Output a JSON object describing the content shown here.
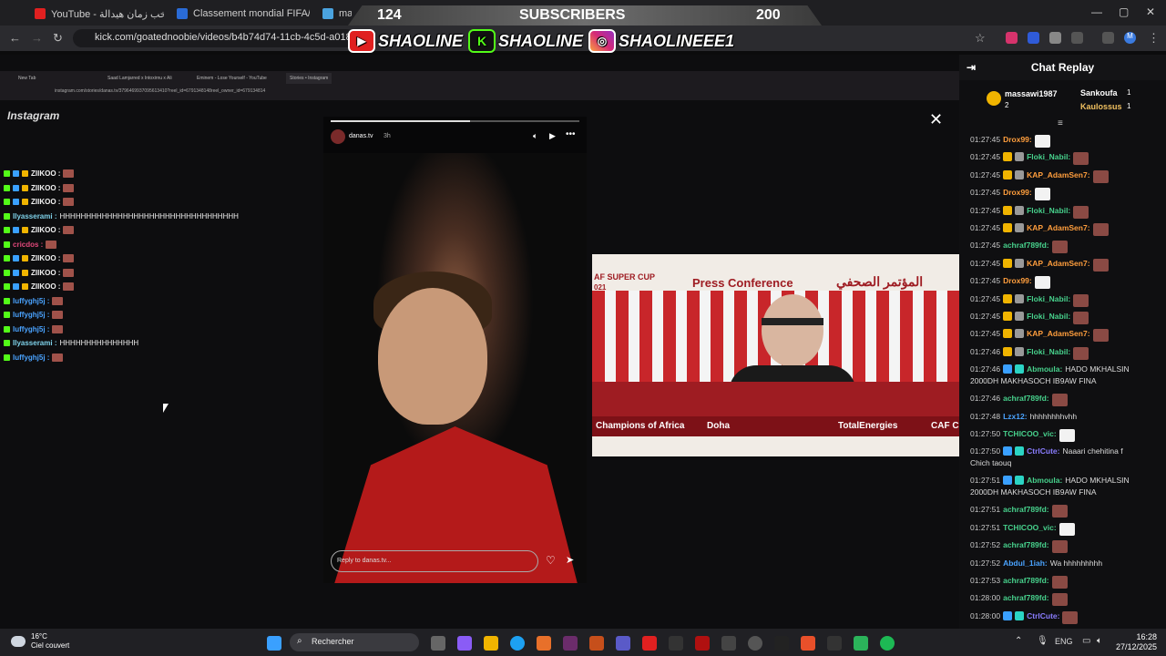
{
  "tabs": [
    {
      "title": "YouTube - منتخب زمان هيدالة",
      "favicon_color": "#e02020"
    },
    {
      "title": "Classement mondial FIFA/Coca",
      "favicon_color": "#2a6bd6"
    },
    {
      "title": "mali -",
      "favicon_color": "#4aa3df"
    }
  ],
  "browser": {
    "url": "kick.com/goatednoobie/videos/b4b74d74-11cb-4c5d-a018-835514",
    "avatar_letter": "M"
  },
  "banner": {
    "left_count": "124",
    "label": "SUBSCRIBERS",
    "right_count": "200",
    "accounts": [
      "SHAOLINE",
      "SHAOLINE",
      "SHAOLINEEE1"
    ]
  },
  "inner_browser": {
    "tabs": [
      "New Tab",
      "Saad Lamjarred x Intoxirnu x Ali",
      "Eminem - Lose Yourself - YouTube",
      "Stories • Instagram"
    ],
    "url": "instagram.com/stories/danas.tv/3796469937095613410?reel_id=6791348148reel_owner_id=679134814"
  },
  "instagram": {
    "logo": "Instagram",
    "story_user": "danas.tv",
    "story_time": "3h",
    "reply_placeholder": "Reply to danas.tv...",
    "progress": 0.56
  },
  "stream_chat": [
    {
      "user": "ZIIKOO :",
      "color": "#f2f2f2"
    },
    {
      "user": "ZIIKOO :",
      "color": "#f2f2f2"
    },
    {
      "user": "ZIIKOO :",
      "color": "#f2f2f2"
    },
    {
      "user": "Ilyasserami :",
      "color": "#7ed1e9",
      "text": "HHHHHHHHHHHHHHHHHHHHHHHHHHHHHHHHHH"
    },
    {
      "user": "ZIIKOO :",
      "color": "#f2f2f2"
    },
    {
      "user": "cricdos :",
      "color": "#e0487a"
    },
    {
      "user": "ZIIKOO :",
      "color": "#f2f2f2"
    },
    {
      "user": "ZIIKOO :",
      "color": "#f2f2f2"
    },
    {
      "user": "ZIIKOO :",
      "color": "#f2f2f2"
    },
    {
      "user": "luffyghj5j :",
      "color": "#4aa3ff"
    },
    {
      "user": "luffyghj5j :",
      "color": "#4aa3ff"
    },
    {
      "user": "luffyghj5j :",
      "color": "#4aa3ff"
    },
    {
      "user": "Ilyasserami :",
      "color": "#7ed1e9",
      "text": "HHHHHHHHHHHHHHH"
    },
    {
      "user": "luffyghj5j :",
      "color": "#4aa3ff"
    }
  ],
  "pip": {
    "title_en": "Press Conference",
    "title_ar": "المؤتمر الصحفي",
    "cup": "AF SUPER CUP",
    "year": "021",
    "footer_left": "Champions of Africa",
    "footer_city": "Doha",
    "footer_sponsor": "TotalEnergies",
    "footer_right": "CAF C"
  },
  "chat_replay": {
    "title": "Chat Replay",
    "top_gifters": [
      {
        "name": "massawi1987",
        "count": "2"
      },
      {
        "name": "Sankoufa",
        "count": "1"
      },
      {
        "name": "Kaulossus",
        "count": "1"
      }
    ],
    "messages": [
      {
        "time": "01:27:45",
        "user": "Drox99:",
        "color": "#ff9e3d",
        "emote": "white"
      },
      {
        "time": "01:27:45",
        "user": "Floki_Nabil:",
        "color": "#47d18c",
        "emote": "red"
      },
      {
        "time": "01:27:45",
        "user": "KAP_AdamSen7:",
        "color": "#ff9e3d",
        "emote": "red"
      },
      {
        "time": "01:27:45",
        "user": "Drox99:",
        "color": "#ff9e3d",
        "emote": "white"
      },
      {
        "time": "01:27:45",
        "user": "Floki_Nabil:",
        "color": "#47d18c",
        "emote": "red"
      },
      {
        "time": "01:27:45",
        "user": "KAP_AdamSen7:",
        "color": "#ff9e3d",
        "emote": "red"
      },
      {
        "time": "01:27:45",
        "user": "achraf789fd:",
        "color": "#47d18c",
        "emote": "red"
      },
      {
        "time": "01:27:45",
        "user": "KAP_AdamSen7:",
        "color": "#ff9e3d",
        "emote": "red"
      },
      {
        "time": "01:27:45",
        "user": "Drox99:",
        "color": "#ff9e3d",
        "emote": "white"
      },
      {
        "time": "01:27:45",
        "user": "Floki_Nabil:",
        "color": "#47d18c",
        "emote": "red"
      },
      {
        "time": "01:27:45",
        "user": "Floki_Nabil:",
        "color": "#47d18c",
        "emote": "red"
      },
      {
        "time": "01:27:45",
        "user": "KAP_AdamSen7:",
        "color": "#ff9e3d",
        "emote": "red"
      },
      {
        "time": "01:27:46",
        "user": "Floki_Nabil:",
        "color": "#47d18c",
        "emote": "red"
      },
      {
        "time": "01:27:46",
        "user": "Abmoula:",
        "color": "#47d18c",
        "text": "HADO MKHALSIN",
        "text2": "2000DH MAKHASOCH IB9AW FINA"
      },
      {
        "time": "01:27:46",
        "user": "achraf789fd:",
        "color": "#47d18c",
        "emote": "red"
      },
      {
        "time": "01:27:48",
        "user": "Lzx12:",
        "color": "#4aa3ff",
        "text": "hhhhhhhhvhh"
      },
      {
        "time": "01:27:50",
        "user": "TCHICOO_vic:",
        "color": "#47d18c",
        "emote": "white"
      },
      {
        "time": "01:27:50",
        "user": "CtrlCute:",
        "color": "#8a7dff",
        "text": "Naaari chehitina f",
        "text2": "Chich taouq"
      },
      {
        "time": "01:27:51",
        "user": "Abmoula:",
        "color": "#47d18c",
        "text": "HADO MKHALSIN",
        "text2": "2000DH MAKHASOCH IB9AW FINA"
      },
      {
        "time": "01:27:51",
        "user": "achraf789fd:",
        "color": "#47d18c",
        "emote": "red"
      },
      {
        "time": "01:27:51",
        "user": "TCHICOO_vic:",
        "color": "#47d18c",
        "emote": "white"
      },
      {
        "time": "01:27:52",
        "user": "achraf789fd:",
        "color": "#47d18c",
        "emote": "red"
      },
      {
        "time": "01:27:52",
        "user": "Abdul_1iah:",
        "color": "#4aa3ff",
        "text": "Wa hhhhhhhhh"
      },
      {
        "time": "01:27:53",
        "user": "achraf789fd:",
        "color": "#47d18c",
        "emote": "red"
      },
      {
        "time": "01:28:00",
        "user": "achraf789fd:",
        "color": "#47d18c",
        "emote": "red"
      },
      {
        "time": "01:28:00",
        "user": "CtrlCute:",
        "color": "#8a7dff",
        "emote": "red"
      }
    ]
  },
  "taskbar": {
    "temperature": "16°C",
    "weather": "Ciel couvert",
    "search": "Rechercher",
    "language": "ENG",
    "time": "16:28",
    "date": "27/12/2025"
  }
}
